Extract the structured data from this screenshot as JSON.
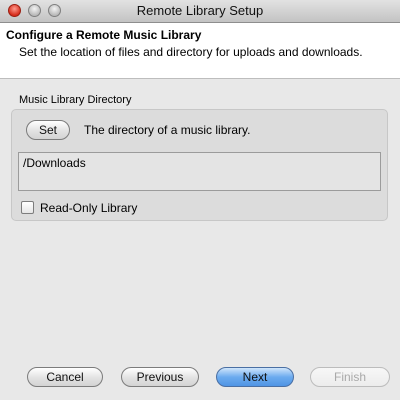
{
  "window": {
    "title": "Remote Library Setup",
    "controls": [
      "close-icon",
      "minimize-icon",
      "zoom-icon"
    ]
  },
  "header": {
    "title": "Configure a Remote Music Library",
    "subtitle": "Set the location of files and directory for uploads and downloads."
  },
  "music_dir": {
    "label": "Music Library Directory",
    "set_button": "Set",
    "description": "The directory of a music library.",
    "path": "/Downloads",
    "read_only_label": "Read-Only Library",
    "read_only_checked": false
  },
  "footer": {
    "cancel": "Cancel",
    "previous": "Previous",
    "next": "Next",
    "finish": "Finish",
    "finish_enabled": false
  },
  "colors": {
    "default_button": "#6cabef",
    "close_light": "#d62d1c"
  }
}
